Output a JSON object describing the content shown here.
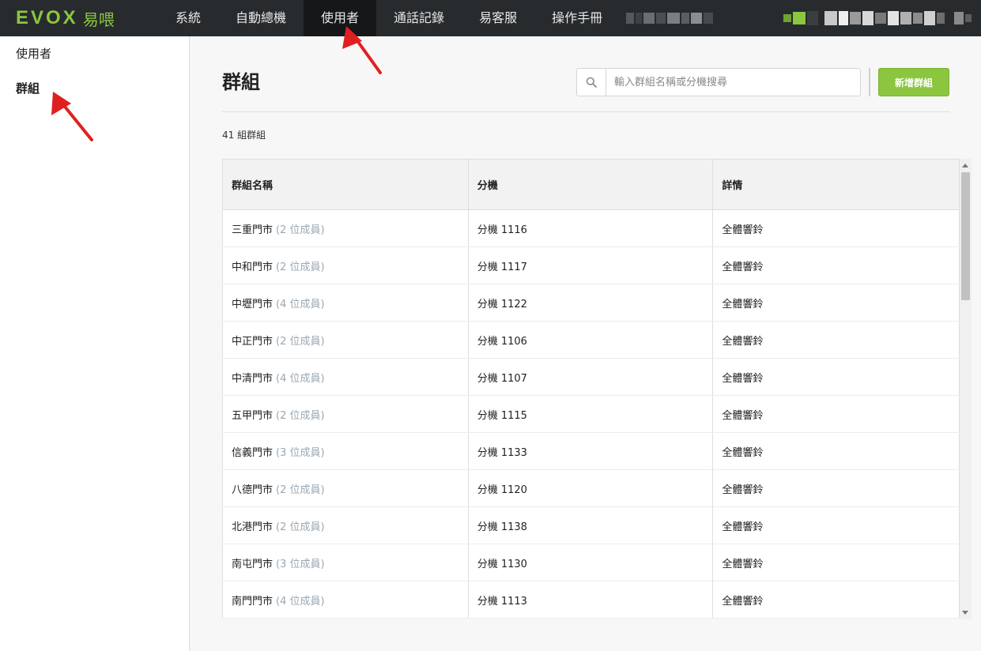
{
  "brand": {
    "logo_text": "EVOX",
    "logo_cn": "易喂"
  },
  "topnav": {
    "items": [
      {
        "label": "系統"
      },
      {
        "label": "自動總機"
      },
      {
        "label": "使用者",
        "active": true
      },
      {
        "label": "通話記錄"
      },
      {
        "label": "易客服"
      },
      {
        "label": "操作手冊"
      }
    ]
  },
  "sidebar": {
    "items": [
      {
        "label": "使用者"
      },
      {
        "label": "群組",
        "active": true
      }
    ]
  },
  "main": {
    "title": "群組",
    "search_placeholder": "輸入群組名稱或分機搜尋",
    "add_button": "新增群組",
    "count_text": "41 組群組"
  },
  "table": {
    "headers": [
      "群組名稱",
      "分機",
      "詳情"
    ],
    "rows": [
      {
        "name": "三重門市",
        "members": "(2 位成員)",
        "ext": "分機 1116",
        "detail": "全體響鈴"
      },
      {
        "name": "中和門市",
        "members": "(2 位成員)",
        "ext": "分機 1117",
        "detail": "全體響鈴"
      },
      {
        "name": "中壢門市",
        "members": "(4 位成員)",
        "ext": "分機 1122",
        "detail": "全體響鈴"
      },
      {
        "name": "中正門市",
        "members": "(2 位成員)",
        "ext": "分機 1106",
        "detail": "全體響鈴"
      },
      {
        "name": "中清門市",
        "members": "(4 位成員)",
        "ext": "分機 1107",
        "detail": "全體響鈴"
      },
      {
        "name": "五甲門市",
        "members": "(2 位成員)",
        "ext": "分機 1115",
        "detail": "全體響鈴"
      },
      {
        "name": "信義門市",
        "members": "(3 位成員)",
        "ext": "分機 1133",
        "detail": "全體響鈴"
      },
      {
        "name": "八德門市",
        "members": "(2 位成員)",
        "ext": "分機 1120",
        "detail": "全體響鈴"
      },
      {
        "name": "北港門市",
        "members": "(2 位成員)",
        "ext": "分機 1138",
        "detail": "全體響鈴"
      },
      {
        "name": "南屯門市",
        "members": "(3 位成員)",
        "ext": "分機 1130",
        "detail": "全體響鈴"
      },
      {
        "name": "南門門市",
        "members": "(4 位成員)",
        "ext": "分機 1113",
        "detail": "全體響鈴"
      }
    ]
  },
  "colors": {
    "brand_green": "#8cc63f",
    "nav_bg": "#272b2e",
    "annotation_red": "#e02020"
  },
  "icons": {
    "search": "search-icon"
  }
}
